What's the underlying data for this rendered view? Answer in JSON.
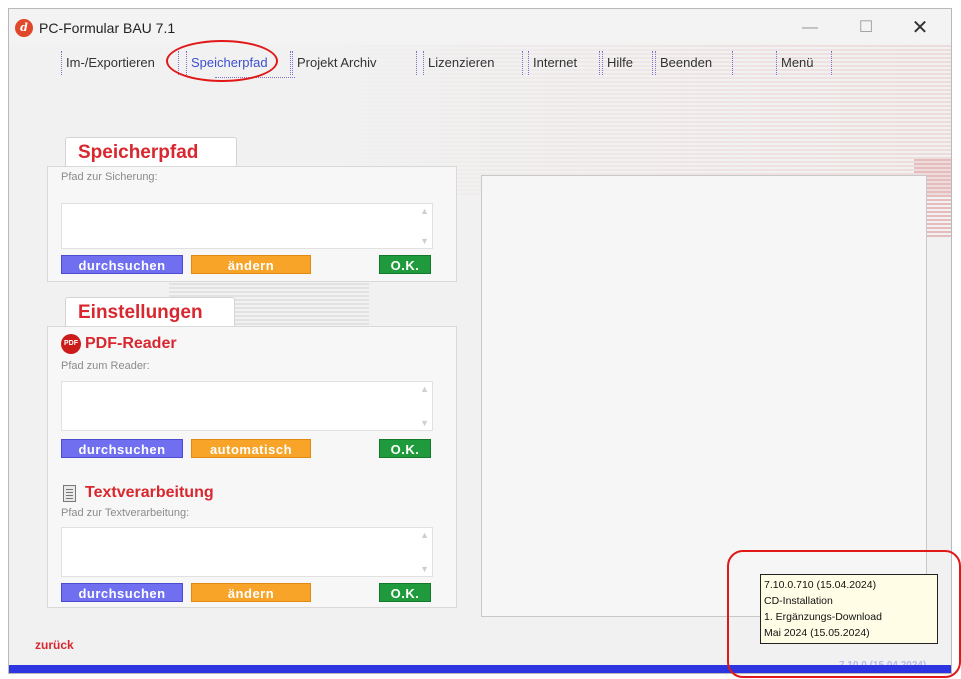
{
  "window": {
    "title": "PC-Formular BAU 7.1",
    "logo_glyph": "d",
    "controls": {
      "minimize": "—",
      "maximize": "☐",
      "close": "✕"
    }
  },
  "menu": {
    "items": [
      {
        "label": "Im-/Exportieren"
      },
      {
        "label": "Speicherpfad",
        "active": true
      },
      {
        "label": "Projekt Archiv"
      },
      {
        "label": "Lizenzieren"
      },
      {
        "label": "Internet"
      },
      {
        "label": "Hilfe"
      },
      {
        "label": "Beenden"
      },
      {
        "label": "Menü"
      }
    ]
  },
  "speicherpfad": {
    "tab_label": "Speicherpfad",
    "field_label": "Pfad zur Sicherung:",
    "value": "",
    "buttons": {
      "browse": "durchsuchen",
      "change": "ändern",
      "ok": "O.K."
    }
  },
  "einstellungen": {
    "tab_label": "Einstellungen",
    "pdf_reader": {
      "title": "PDF-Reader",
      "icon_text": "PDF",
      "field_label": "Pfad zum Reader:",
      "value": "",
      "buttons": {
        "browse": "durchsuchen",
        "auto": "automatisch",
        "ok": "O.K."
      }
    },
    "textverarbeitung": {
      "title": "Textverarbeitung",
      "field_label": "Pfad zur Textverarbeitung:",
      "value": "",
      "buttons": {
        "browse": "durchsuchen",
        "change": "ändern",
        "ok": "O.K."
      }
    }
  },
  "footer": {
    "back_label": "zurück",
    "version": "7.10.0 (15.04.2024)"
  },
  "info_popup": {
    "lines": [
      "7.10.0.710 (15.04.2024)",
      "CD-Installation",
      "1. Ergänzungs-Download",
      "Mai 2024 (15.05.2024)"
    ]
  },
  "colors": {
    "accent_red": "#d8272e",
    "button_blue": "#6f6ff0",
    "button_orange": "#f7a429",
    "button_green": "#1f9a3c",
    "bottom_bar": "#2d35e0",
    "annotation_red": "#e01818"
  }
}
